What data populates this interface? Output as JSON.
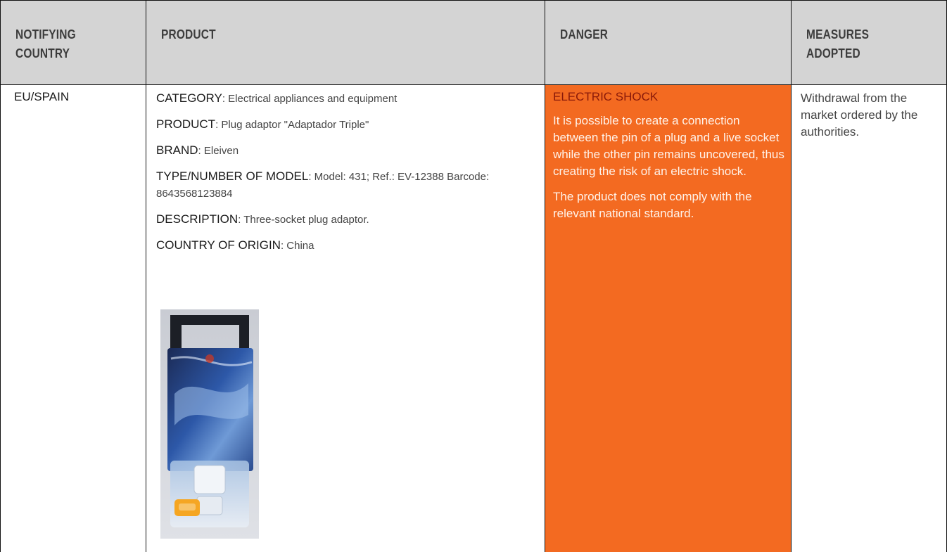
{
  "table": {
    "headers": {
      "col1": [
        "NOTIFYING",
        "COUNTRY"
      ],
      "col2": [
        "PRODUCT"
      ],
      "col3": [
        "DANGER"
      ],
      "col4": [
        "MEASURES",
        "ADOPTED"
      ]
    },
    "row": {
      "country": "EU/SPAIN",
      "product": [
        {
          "label": "CATEGORY",
          "value": ": Electrical appliances and equipment"
        },
        {
          "label": "PRODUCT",
          "value": ": Plug adaptor \"Adaptador Triple\""
        },
        {
          "label": "BRAND",
          "value": ": Eleiven"
        },
        {
          "label": "TYPE/NUMBER OF MODEL",
          "value": ": Model: 431; Ref.: EV-12388 Barcode: 8643568123884"
        },
        {
          "label": "DESCRIPTION",
          "value": ": Three-socket plug adaptor."
        },
        {
          "label": "COUNTRY OF ORIGIN",
          "value": ": China"
        }
      ],
      "danger": {
        "title": "ELECTRIC SHOCK",
        "paragraphs": [
          "It is possible to create a connection between the pin of a plug and a live socket while the other pin remains uncovered, thus creating the risk of an electric shock.",
          "The product does not comply with the relevant national standard."
        ]
      },
      "measures": "Withdrawal from the market ordered by the authorities."
    },
    "colors": {
      "header_bg": "#d4d4d4",
      "danger_bg": "#f36a21",
      "danger_title": "#8a1a0a",
      "rules": "#111111"
    }
  }
}
